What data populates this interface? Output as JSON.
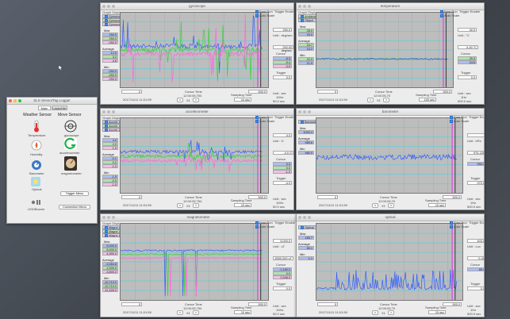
{
  "desktop": {
    "color": "#4a4f57"
  },
  "launcher": {
    "title": "SLS SensorTag Logger",
    "tabs": [
      "Main",
      "LauncHer"
    ],
    "weather_header": "Weather Sensor",
    "move_header": "Move Sensor",
    "items": [
      {
        "label": "Temperature",
        "icon": "thermometer-icon"
      },
      {
        "label": "gyroscope",
        "icon": "gyroscope-icon"
      },
      {
        "label": "Humidity",
        "icon": "humidity-icon"
      },
      {
        "label": "accelerometer",
        "icon": "accelerometer-icon"
      },
      {
        "label": "Barometer",
        "icon": "barometer-icon"
      },
      {
        "label": "magnetometer",
        "icon": "magnetometer-icon"
      },
      {
        "label": "Optical",
        "icon": "optical-icon"
      }
    ],
    "trigger_menu": "Trigger Menu",
    "connection_menu": "Connection Menu",
    "led_label": "LED/Buzzer"
  },
  "windows": [
    {
      "id": "gyro",
      "title": "gyroscope",
      "legend_title": "Graph Display",
      "series": [
        {
          "name": "Gyroscope X",
          "color": "#2f5cff"
        },
        {
          "name": "Gyroscope Y",
          "color": "#39d039"
        },
        {
          "name": "Gyroscope Z",
          "color": "#ff66dd"
        }
      ],
      "free_run": "Free Run",
      "auto_scale": "Auto Scale",
      "trigger_enable": "Trigger Enable",
      "stats": {
        "max_label": "Max",
        "max": [
          "250.0",
          "250.0",
          "-250.0"
        ],
        "avg_label": "Average",
        "avg": [
          "-12.5",
          "3.2",
          "-4.8"
        ],
        "min_label": "Min",
        "min": [
          "-250.0",
          "-250.0",
          "-250.0"
        ]
      },
      "right": {
        "val1": "250.0",
        "unit_label": "Unit : deg/sec",
        "range": "250.00 deg/sec",
        "sens": "2.0",
        "cursor_label": "Cursor",
        "cursor_vals": [
          "-6.3",
          "-9.4",
          "-3.5"
        ],
        "trigger_label": "Trigger",
        "trigger_val": "0.0",
        "unit2": "Unit : sec",
        "rate": "10Hz",
        "sec": "50.0 sec"
      },
      "cursor_time_label": "Cursor Time",
      "cursor_time": "12:00:05.754",
      "sampling_label": "Sampling Time",
      "sampling": "10 sec",
      "x_zoom": "X1",
      "left_box": "0",
      "right_box": "500.0",
      "date": "2017/11/11 11:01:59"
    },
    {
      "id": "temp",
      "title": "temperature",
      "legend_title": "Graph Display",
      "series": [
        {
          "name": "Ambience",
          "color": "#39d039"
        },
        {
          "name": "Object",
          "color": "#2f5cff"
        }
      ],
      "free_run": "Free Run",
      "auto_scale": "Auto Scale",
      "trigger_enable": "Trigger Enable",
      "stats": {
        "max_label": "Max",
        "max": [
          "28.0",
          "25.0"
        ],
        "avg_label": "Average",
        "avg": [
          "24.7",
          "24.2"
        ],
        "min_label": "Min",
        "min": [
          "22.9",
          "21.5"
        ]
      },
      "right": {
        "val1": "40.0",
        "unit_label": "Unit : °C",
        "range": "0-40 °C",
        "sens": "6.00",
        "cursor_label": "Cursor",
        "cursor_vals": [
          "25.3",
          "24.5"
        ],
        "trigger_label": "Trigger",
        "trigger_val": "0.0",
        "unit2": "Unit : sec",
        "rate": "1Hz",
        "sec": "500.0 sec"
      },
      "cursor_time_label": "Cursor Time",
      "cursor_time": "12:00:05.70",
      "sampling_label": "Sampling Time",
      "sampling": "100 sec",
      "x_zoom": "X1",
      "left_box": "0",
      "right_box": "500.0",
      "date": "2017/11/11 11:01:59"
    },
    {
      "id": "accel",
      "title": "accelerometer",
      "legend_title": "Graph Display",
      "series": [
        {
          "name": "Accele X",
          "color": "#2f5cff"
        },
        {
          "name": "Accele Y",
          "color": "#39d039"
        },
        {
          "name": "Accele Z",
          "color": "#ff66dd"
        }
      ],
      "free_run": "Free Run",
      "auto_scale": "Auto Scale",
      "trigger_enable": "Trigger Enable",
      "stats": {
        "max_label": "Max",
        "max": [
          "4.0",
          "2.0",
          "1.5"
        ],
        "avg_label": "Average",
        "avg": [
          "-0.1",
          "0.2",
          "-1.0"
        ],
        "min_label": "Min",
        "min": [
          "-1.5",
          "-2.0",
          "-1.5"
        ]
      },
      "right": {
        "val1": "4.0",
        "unit_label": "Unit : G",
        "range": "-4.0 G",
        "sens": "KX",
        "cursor_label": "Cursor",
        "cursor_vals": [
          "0.0",
          "0.0",
          "-1.0"
        ],
        "trigger_label": "Trigger",
        "trigger_val": "-4.0",
        "unit2": "Unit : sec",
        "rate": "10Hz",
        "sec": "50.0 sec"
      },
      "cursor_time_label": "Cursor Time",
      "cursor_time": "12:00:05.754",
      "sampling_label": "Sampling Time",
      "sampling": "10 sec",
      "x_zoom": "X1",
      "left_box": "0",
      "right_box": "500.0",
      "date": "2017/11/11 11:01:59"
    },
    {
      "id": "baro",
      "title": "barometer",
      "legend_title": "",
      "series": [
        {
          "name": "Barometer",
          "color": "#2f5cff"
        }
      ],
      "free_run": "Free Run",
      "auto_scale": "Auto Scale",
      "trigger_enable": "Trigger Enable",
      "stats": {
        "max_label": "Max",
        "max": [
          "1000.4"
        ],
        "avg_label": "Average",
        "avg": [
          "989.6"
        ],
        "min_label": "Min",
        "min": [
          "980.9"
        ]
      },
      "right": {
        "val1": "",
        "unit_label": "Unit : hPa",
        "range": "970-1550",
        "sens": "",
        "cursor_label": "Cursor",
        "cursor_vals": [
          "994.7"
        ],
        "trigger_label": "Trigger",
        "trigger_val": "970.0",
        "unit2": "Unit : sec",
        "rate": "1Hz",
        "sec": "500.0 sec"
      },
      "cursor_time_label": "Cursor Time",
      "cursor_time": "12:00:05.70",
      "sampling_label": "Sampling Time",
      "sampling": "10 sec",
      "x_zoom": "X1",
      "left_box": "0",
      "right_box": "500.0",
      "date": "2017/11/11 11:01:59"
    },
    {
      "id": "magnet",
      "title": "magnetometer",
      "legend_title": "Graph Display",
      "series": [
        {
          "name": "Magne X",
          "color": "#2f5cff"
        },
        {
          "name": "Magne Y",
          "color": "#39d039"
        },
        {
          "name": "Magne Z",
          "color": "#ff66dd"
        }
      ],
      "free_run": "Free Run",
      "auto_scale": "Auto Scale",
      "trigger_enable": "Trigger Enable",
      "stats": {
        "max_label": "Max",
        "max": [
          "5,000.0",
          "5,000.0",
          "4,990.0"
        ],
        "avg_label": "Average",
        "avg": [
          "-3,064.8",
          "1,000.0",
          "-3,800.0"
        ],
        "min_label": "Min",
        "min": [
          "-10,710.0",
          "-10,710.0",
          "-11,326.0"
        ]
      },
      "right": {
        "val1": "5,000.0",
        "unit_label": "Unit : uT",
        "range": "-5000.000 uT",
        "sens": "",
        "cursor_label": "Cursor",
        "cursor_vals": [
          "-1,180.0",
          "0.0",
          "2,548.0"
        ],
        "trigger_label": "Trigger",
        "trigger_val": "0.0",
        "unit2": "Unit : sec",
        "rate": "10Hz",
        "sec": "50.0 sec"
      },
      "cursor_time_label": "Cursor Time",
      "cursor_time": "12:00:05.754",
      "sampling_label": "Sampling Time",
      "sampling": "10 sec",
      "x_zoom": "X1",
      "left_box": "0",
      "right_box": "500.0",
      "date": "2017/11/11 11:01:59"
    },
    {
      "id": "optical",
      "title": "optical",
      "legend_title": "",
      "series": [
        {
          "name": "Optical",
          "color": "#2f5cff"
        }
      ],
      "free_run": "Free Run",
      "auto_scale": "Auto Scale",
      "trigger_enable": "Trigger Enable",
      "stats": {
        "max_label": "Max",
        "max": [
          "180.7"
        ],
        "avg_label": "Average",
        "avg": [
          "89.1"
        ],
        "min_label": "Min",
        "min": [
          "1.1"
        ]
      },
      "right": {
        "val1": "403.0",
        "unit_label": "Unit : Lux",
        "range": "0-400",
        "sens": "",
        "cursor_label": "Cursor",
        "cursor_vals": [
          "89.4"
        ],
        "trigger_label": "Trigger",
        "trigger_val": "0.0",
        "unit2": "Unit : sec",
        "rate": "1Hz",
        "sec": "500.0 sec"
      },
      "cursor_time_label": "Cursor Time",
      "cursor_time": "12:00:05.70",
      "sampling_label": "Sampling Time",
      "sampling": "10 sec",
      "x_zoom": "X1",
      "left_box": "0",
      "right_box": "500.0",
      "date": "2017/11/11 11:01:59"
    }
  ]
}
